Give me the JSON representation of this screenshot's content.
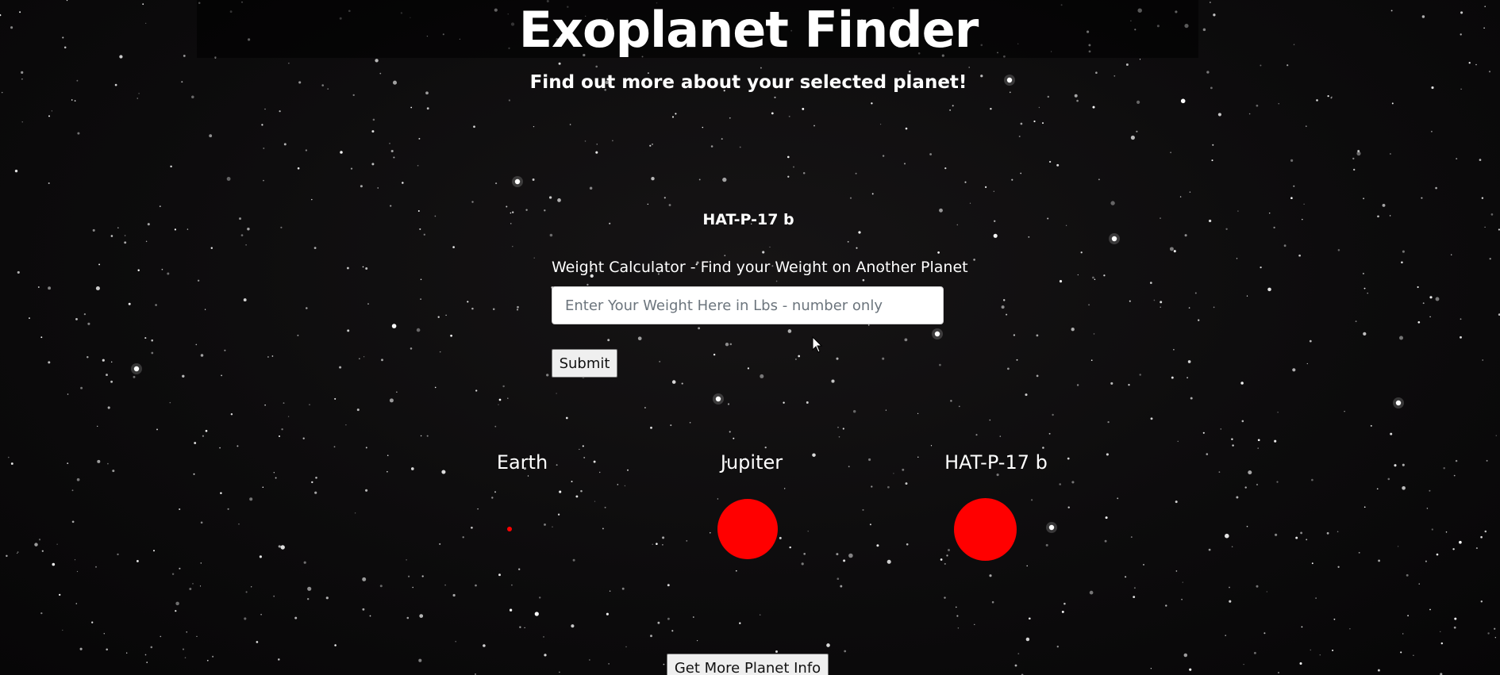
{
  "header": {
    "title": "Exoplanet Finder",
    "subtitle": "Find out more about your selected planet!"
  },
  "selected_planet": {
    "name": "HAT-P-17 b"
  },
  "weight_calculator": {
    "label": "Weight Calculator - Find your Weight on Another Planet",
    "input_value": "",
    "input_placeholder": "Enter Your Weight Here in Lbs - number only",
    "submit_label": "Submit"
  },
  "size_comparison": {
    "planets": [
      {
        "label": "Earth",
        "color": "#ff0000",
        "icon": "planet-circle"
      },
      {
        "label": "Jupiter",
        "color": "#ff0000",
        "icon": "planet-circle"
      },
      {
        "label": "HAT-P-17 b",
        "color": "#ff0000",
        "icon": "planet-circle"
      }
    ]
  },
  "more_info_button": {
    "label": "Get More Planet Info"
  },
  "colors": {
    "background": "#0b0a0b",
    "text": "#ffffff",
    "planet": "#ff0000",
    "button_bg": "#efefef"
  }
}
